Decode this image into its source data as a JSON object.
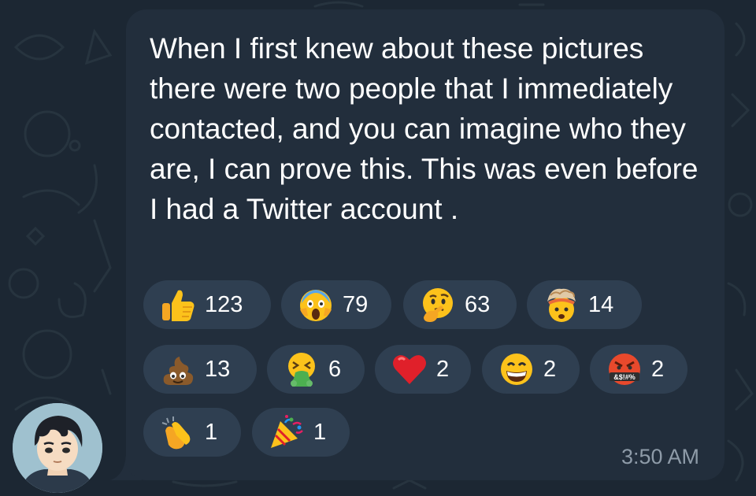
{
  "message": {
    "text": "When I first knew about these pictures there were two people that I immediately contacted, and you can imagine who they are, I can prove this. This was even before I had a Twitter account .",
    "time": "3:50 AM"
  },
  "reactions": [
    {
      "emoji": "thumbs-up-icon",
      "count": "123"
    },
    {
      "emoji": "screaming-face-icon",
      "count": "79"
    },
    {
      "emoji": "thinking-face-icon",
      "count": "63"
    },
    {
      "emoji": "exploding-head-icon",
      "count": "14"
    },
    {
      "emoji": "pile-of-poo-icon",
      "count": "13"
    },
    {
      "emoji": "vomiting-face-icon",
      "count": "6"
    },
    {
      "emoji": "red-heart-icon",
      "count": "2"
    },
    {
      "emoji": "grinning-face-icon",
      "count": "2"
    },
    {
      "emoji": "cursing-face-icon",
      "count": "2"
    },
    {
      "emoji": "clapping-hands-icon",
      "count": "1"
    },
    {
      "emoji": "party-popper-icon",
      "count": "1"
    }
  ],
  "colors": {
    "background": "#1c2733",
    "bubble": "#222e3c",
    "reaction_pill": "#2f3f51",
    "timestamp": "#8e9ba8"
  },
  "cursing_symbols": "&$!#%",
  "avatar": {
    "icon": "user-avatar-icon"
  }
}
